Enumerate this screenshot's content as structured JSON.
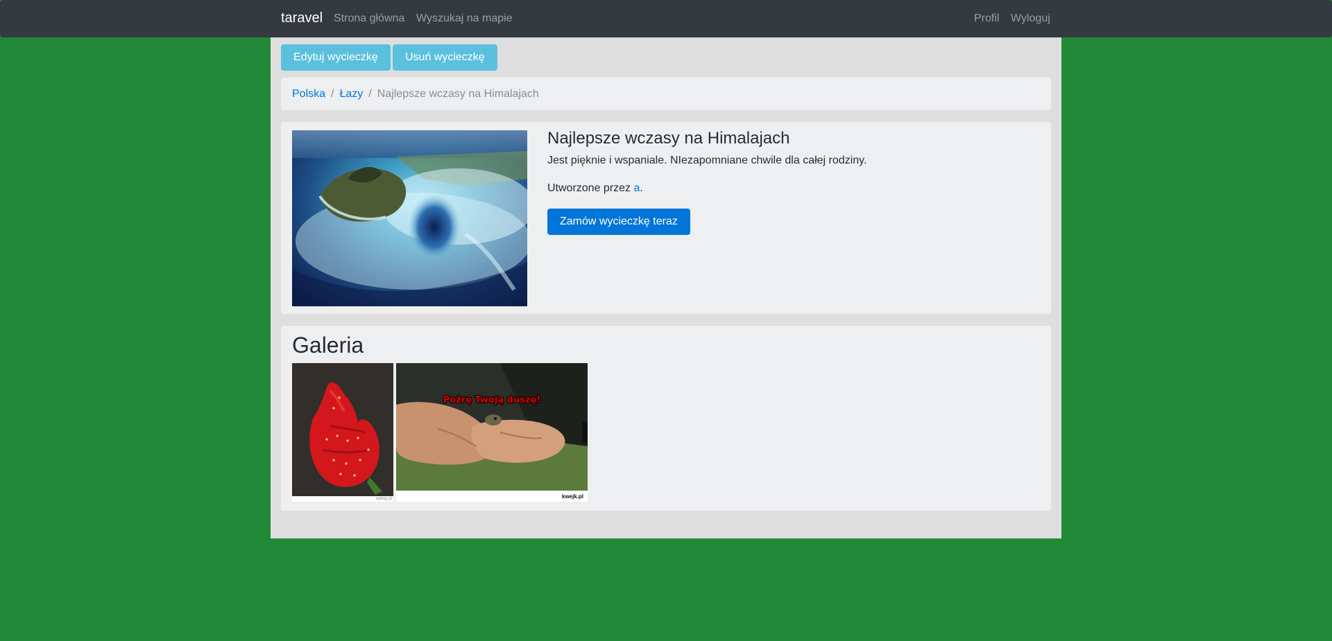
{
  "navbar": {
    "brand": "taravel",
    "left_links": [
      "Strona główna",
      "Wyszukaj na mapie"
    ],
    "right_links": [
      "Profil",
      "Wyloguj"
    ]
  },
  "actions": {
    "edit_label": "Edytuj wycieczkę",
    "delete_label": "Usuń wycieczkę"
  },
  "breadcrumb": {
    "items": [
      "Polska",
      "Łazy"
    ],
    "separator": "/",
    "active": "Najlepsze wczasy na Himalajach"
  },
  "trip": {
    "title": "Najlepsze wczasy na Himalajach",
    "description": "Jest pięknie i wspaniale. NIezapomniane chwile dla całej rodziny.",
    "created_by_prefix": "Utworzone przez",
    "author": "a",
    "created_by_suffix": ".",
    "order_label": "Zamów wycieczkę teraz",
    "image_icon": "aerial-island-photo"
  },
  "gallery": {
    "title": "Galeria",
    "images": [
      {
        "icon": "strawberry-photo",
        "caption_footer": "wykop.pl"
      },
      {
        "icon": "hands-frog-photo",
        "caption_overlay": "Pożrę Twoją duszę!",
        "caption_footer": "kwejk.pl"
      }
    ]
  },
  "colors": {
    "background": "#218838",
    "navbar": "#343a40",
    "container": "#dedede",
    "card": "#eeeff1",
    "info_button": "#5bc0de",
    "primary_button": "#0275d8",
    "link": "#0275d8"
  }
}
